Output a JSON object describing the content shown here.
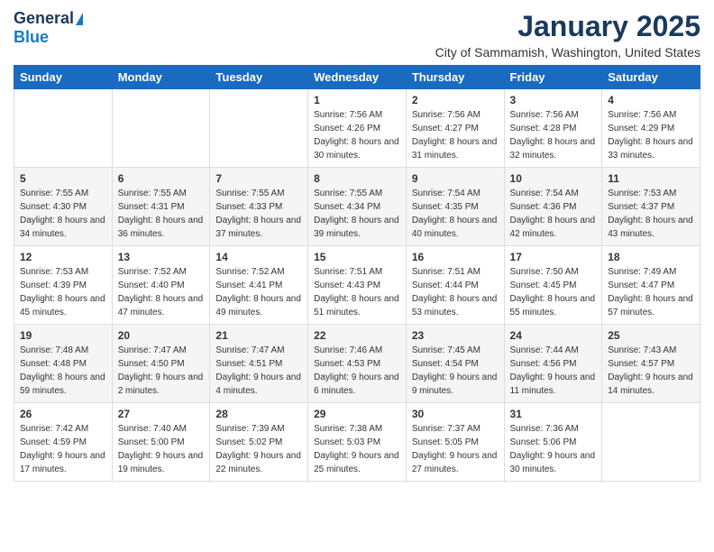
{
  "logo": {
    "general": "General",
    "blue": "Blue"
  },
  "title": "January 2025",
  "subtitle": "City of Sammamish, Washington, United States",
  "days_of_week": [
    "Sunday",
    "Monday",
    "Tuesday",
    "Wednesday",
    "Thursday",
    "Friday",
    "Saturday"
  ],
  "weeks": [
    [
      {
        "day": "",
        "sunrise": "",
        "sunset": "",
        "daylight": ""
      },
      {
        "day": "",
        "sunrise": "",
        "sunset": "",
        "daylight": ""
      },
      {
        "day": "",
        "sunrise": "",
        "sunset": "",
        "daylight": ""
      },
      {
        "day": "1",
        "sunrise": "Sunrise: 7:56 AM",
        "sunset": "Sunset: 4:26 PM",
        "daylight": "Daylight: 8 hours and 30 minutes."
      },
      {
        "day": "2",
        "sunrise": "Sunrise: 7:56 AM",
        "sunset": "Sunset: 4:27 PM",
        "daylight": "Daylight: 8 hours and 31 minutes."
      },
      {
        "day": "3",
        "sunrise": "Sunrise: 7:56 AM",
        "sunset": "Sunset: 4:28 PM",
        "daylight": "Daylight: 8 hours and 32 minutes."
      },
      {
        "day": "4",
        "sunrise": "Sunrise: 7:56 AM",
        "sunset": "Sunset: 4:29 PM",
        "daylight": "Daylight: 8 hours and 33 minutes."
      }
    ],
    [
      {
        "day": "5",
        "sunrise": "Sunrise: 7:55 AM",
        "sunset": "Sunset: 4:30 PM",
        "daylight": "Daylight: 8 hours and 34 minutes."
      },
      {
        "day": "6",
        "sunrise": "Sunrise: 7:55 AM",
        "sunset": "Sunset: 4:31 PM",
        "daylight": "Daylight: 8 hours and 36 minutes."
      },
      {
        "day": "7",
        "sunrise": "Sunrise: 7:55 AM",
        "sunset": "Sunset: 4:33 PM",
        "daylight": "Daylight: 8 hours and 37 minutes."
      },
      {
        "day": "8",
        "sunrise": "Sunrise: 7:55 AM",
        "sunset": "Sunset: 4:34 PM",
        "daylight": "Daylight: 8 hours and 39 minutes."
      },
      {
        "day": "9",
        "sunrise": "Sunrise: 7:54 AM",
        "sunset": "Sunset: 4:35 PM",
        "daylight": "Daylight: 8 hours and 40 minutes."
      },
      {
        "day": "10",
        "sunrise": "Sunrise: 7:54 AM",
        "sunset": "Sunset: 4:36 PM",
        "daylight": "Daylight: 8 hours and 42 minutes."
      },
      {
        "day": "11",
        "sunrise": "Sunrise: 7:53 AM",
        "sunset": "Sunset: 4:37 PM",
        "daylight": "Daylight: 8 hours and 43 minutes."
      }
    ],
    [
      {
        "day": "12",
        "sunrise": "Sunrise: 7:53 AM",
        "sunset": "Sunset: 4:39 PM",
        "daylight": "Daylight: 8 hours and 45 minutes."
      },
      {
        "day": "13",
        "sunrise": "Sunrise: 7:52 AM",
        "sunset": "Sunset: 4:40 PM",
        "daylight": "Daylight: 8 hours and 47 minutes."
      },
      {
        "day": "14",
        "sunrise": "Sunrise: 7:52 AM",
        "sunset": "Sunset: 4:41 PM",
        "daylight": "Daylight: 8 hours and 49 minutes."
      },
      {
        "day": "15",
        "sunrise": "Sunrise: 7:51 AM",
        "sunset": "Sunset: 4:43 PM",
        "daylight": "Daylight: 8 hours and 51 minutes."
      },
      {
        "day": "16",
        "sunrise": "Sunrise: 7:51 AM",
        "sunset": "Sunset: 4:44 PM",
        "daylight": "Daylight: 8 hours and 53 minutes."
      },
      {
        "day": "17",
        "sunrise": "Sunrise: 7:50 AM",
        "sunset": "Sunset: 4:45 PM",
        "daylight": "Daylight: 8 hours and 55 minutes."
      },
      {
        "day": "18",
        "sunrise": "Sunrise: 7:49 AM",
        "sunset": "Sunset: 4:47 PM",
        "daylight": "Daylight: 8 hours and 57 minutes."
      }
    ],
    [
      {
        "day": "19",
        "sunrise": "Sunrise: 7:48 AM",
        "sunset": "Sunset: 4:48 PM",
        "daylight": "Daylight: 8 hours and 59 minutes."
      },
      {
        "day": "20",
        "sunrise": "Sunrise: 7:47 AM",
        "sunset": "Sunset: 4:50 PM",
        "daylight": "Daylight: 9 hours and 2 minutes."
      },
      {
        "day": "21",
        "sunrise": "Sunrise: 7:47 AM",
        "sunset": "Sunset: 4:51 PM",
        "daylight": "Daylight: 9 hours and 4 minutes."
      },
      {
        "day": "22",
        "sunrise": "Sunrise: 7:46 AM",
        "sunset": "Sunset: 4:53 PM",
        "daylight": "Daylight: 9 hours and 6 minutes."
      },
      {
        "day": "23",
        "sunrise": "Sunrise: 7:45 AM",
        "sunset": "Sunset: 4:54 PM",
        "daylight": "Daylight: 9 hours and 9 minutes."
      },
      {
        "day": "24",
        "sunrise": "Sunrise: 7:44 AM",
        "sunset": "Sunset: 4:56 PM",
        "daylight": "Daylight: 9 hours and 11 minutes."
      },
      {
        "day": "25",
        "sunrise": "Sunrise: 7:43 AM",
        "sunset": "Sunset: 4:57 PM",
        "daylight": "Daylight: 9 hours and 14 minutes."
      }
    ],
    [
      {
        "day": "26",
        "sunrise": "Sunrise: 7:42 AM",
        "sunset": "Sunset: 4:59 PM",
        "daylight": "Daylight: 9 hours and 17 minutes."
      },
      {
        "day": "27",
        "sunrise": "Sunrise: 7:40 AM",
        "sunset": "Sunset: 5:00 PM",
        "daylight": "Daylight: 9 hours and 19 minutes."
      },
      {
        "day": "28",
        "sunrise": "Sunrise: 7:39 AM",
        "sunset": "Sunset: 5:02 PM",
        "daylight": "Daylight: 9 hours and 22 minutes."
      },
      {
        "day": "29",
        "sunrise": "Sunrise: 7:38 AM",
        "sunset": "Sunset: 5:03 PM",
        "daylight": "Daylight: 9 hours and 25 minutes."
      },
      {
        "day": "30",
        "sunrise": "Sunrise: 7:37 AM",
        "sunset": "Sunset: 5:05 PM",
        "daylight": "Daylight: 9 hours and 27 minutes."
      },
      {
        "day": "31",
        "sunrise": "Sunrise: 7:36 AM",
        "sunset": "Sunset: 5:06 PM",
        "daylight": "Daylight: 9 hours and 30 minutes."
      },
      {
        "day": "",
        "sunrise": "",
        "sunset": "",
        "daylight": ""
      }
    ]
  ]
}
